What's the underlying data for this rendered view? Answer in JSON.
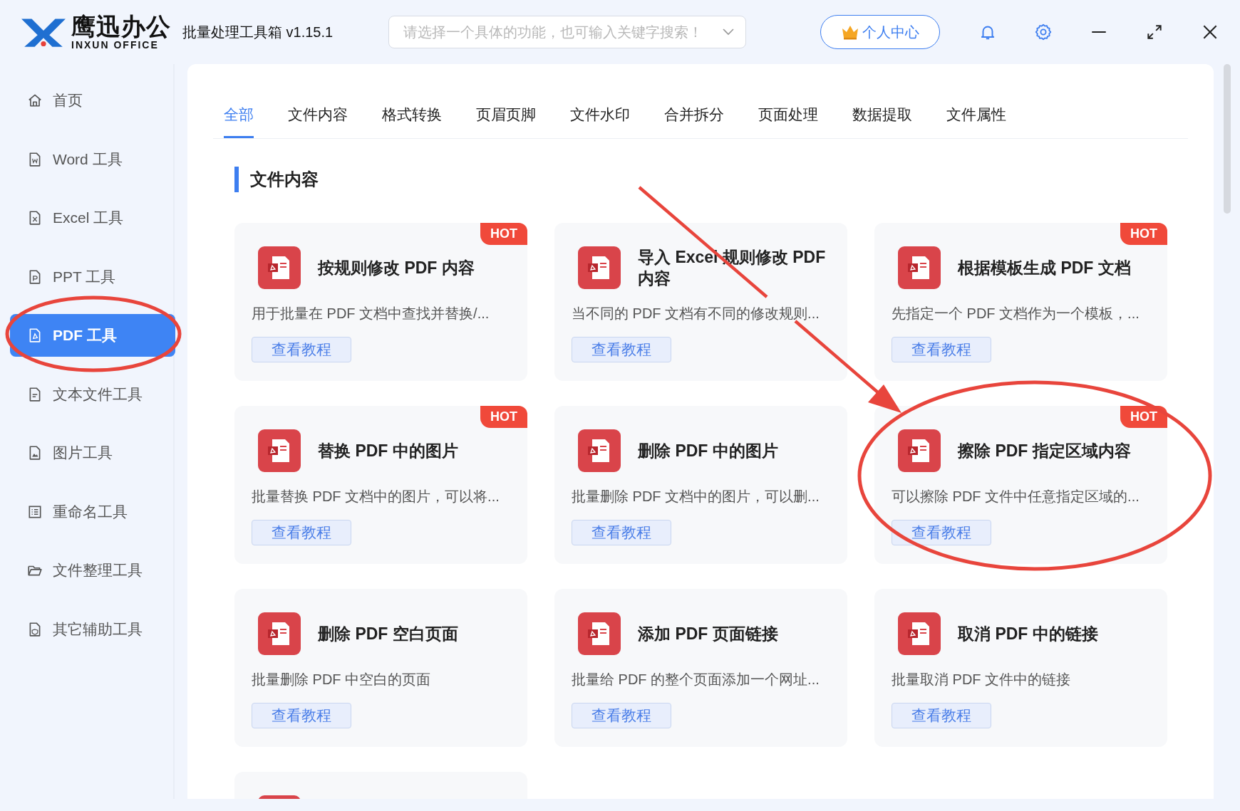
{
  "header": {
    "logo": {
      "name": "鹰迅办公",
      "subtitle": "INXUN OFFICE"
    },
    "app_title": "批量处理工具箱 v1.15.1",
    "search": {
      "placeholder": "请选择一个具体的功能，也可输入关键字搜索！"
    },
    "user_button": "个人中心"
  },
  "sidebar": {
    "items": [
      {
        "label": "首页",
        "selected": false
      },
      {
        "label": "Word 工具",
        "selected": false
      },
      {
        "label": "Excel 工具",
        "selected": false
      },
      {
        "label": "PPT 工具",
        "selected": false
      },
      {
        "label": "PDF 工具",
        "selected": true
      },
      {
        "label": "文本文件工具",
        "selected": false
      },
      {
        "label": "图片工具",
        "selected": false
      },
      {
        "label": "重命名工具",
        "selected": false
      },
      {
        "label": "文件整理工具",
        "selected": false
      },
      {
        "label": "其它辅助工具",
        "selected": false
      }
    ]
  },
  "tabs": [
    {
      "label": "全部",
      "selected": true
    },
    {
      "label": "文件内容",
      "selected": false
    },
    {
      "label": "格式转换",
      "selected": false
    },
    {
      "label": "页眉页脚",
      "selected": false
    },
    {
      "label": "文件水印",
      "selected": false
    },
    {
      "label": "合并拆分",
      "selected": false
    },
    {
      "label": "页面处理",
      "selected": false
    },
    {
      "label": "数据提取",
      "selected": false
    },
    {
      "label": "文件属性",
      "selected": false
    }
  ],
  "section_title": "文件内容",
  "cards": [
    {
      "kind": "full",
      "title": "按规则修改 PDF 内容",
      "description": "用于批量在 PDF 文档中查找并替换/...",
      "button": "查看教程",
      "hot": true,
      "badge_text": "HOT"
    },
    {
      "kind": "full",
      "title": "导入 Excel 规则修改 PDF 内容",
      "description": "当不同的 PDF 文档有不同的修改规则...",
      "button": "查看教程",
      "hot": false
    },
    {
      "kind": "full",
      "title": "根据模板生成 PDF 文档",
      "description": "先指定一个 PDF 文档作为一个模板，...",
      "button": "查看教程",
      "hot": true,
      "badge_text": "HOT"
    },
    {
      "kind": "full",
      "title": "替换 PDF 中的图片",
      "description": "批量替换 PDF 文档中的图片，可以将...",
      "button": "查看教程",
      "hot": true,
      "badge_text": "HOT"
    },
    {
      "kind": "full",
      "title": "删除 PDF 中的图片",
      "description": "批量删除 PDF 文档中的图片，可以删...",
      "button": "查看教程",
      "hot": false
    },
    {
      "kind": "full",
      "title": "擦除 PDF 指定区域内容",
      "description": "可以擦除 PDF 文件中任意指定区域的...",
      "button": "查看教程",
      "hot": true,
      "badge_text": "HOT"
    },
    {
      "kind": "full",
      "title": "删除 PDF 空白页面",
      "description": "批量删除 PDF 中空白的页面",
      "button": "查看教程",
      "hot": false
    },
    {
      "kind": "full",
      "title": "添加 PDF 页面链接",
      "description": "批量给 PDF 的整个页面添加一个网址...",
      "button": "查看教程",
      "hot": false
    },
    {
      "kind": "full",
      "title": "取消 PDF 中的链接",
      "description": "批量取消 PDF 文件中的链接",
      "button": "查看教程",
      "hot": false
    },
    {
      "kind": "cut_off"
    }
  ],
  "annotations": [
    {
      "kind": "sidebar_ellipse"
    },
    {
      "kind": "arrow"
    },
    {
      "kind": "card_ellipse"
    }
  ]
}
